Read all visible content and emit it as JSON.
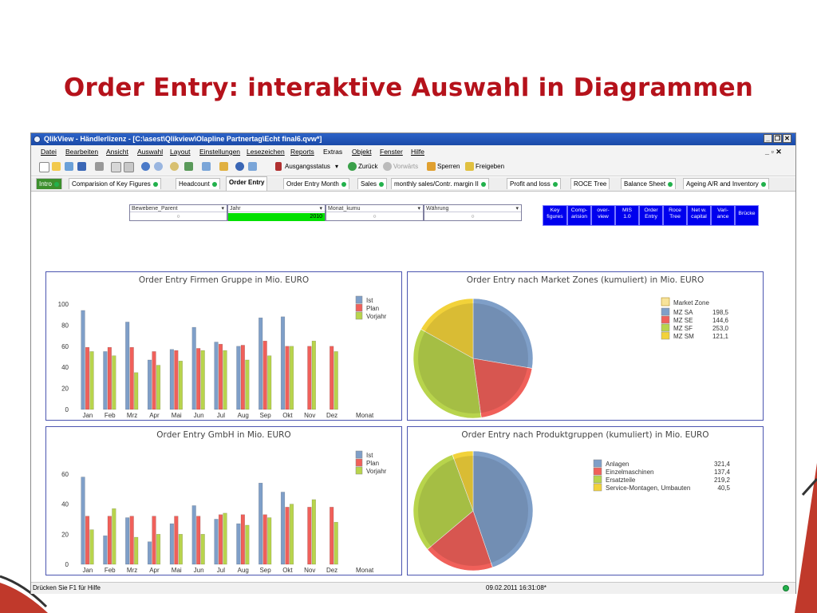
{
  "slide": {
    "title": "Order Entry: interaktive Auswahl in Diagrammen"
  },
  "window": {
    "title": "QlikView - Händlerlizenz - [C:\\asest\\Qlikview\\Olapline Partnertag\\Echt final6.qvw*]",
    "buttons": [
      "_",
      "❐",
      "✕"
    ]
  },
  "menu": {
    "items": [
      "Datei",
      "Bearbeiten",
      "Ansicht",
      "Auswahl",
      "Layout",
      "Einstellungen",
      "Lesezeichen",
      "Reports",
      "Extras",
      "Objekt",
      "Fenster",
      "Hilfe"
    ],
    "mdi_controls": "_ ▫ ✕"
  },
  "toolbar": {
    "ausgangsstatus": "Ausgangsstatus",
    "zurueck": "Zurück",
    "vorwaerts": "Vorwärts",
    "sperren": "Sperren",
    "freigeben": "Freigeben"
  },
  "tabs": [
    {
      "label": "Intro",
      "dot": true
    },
    {
      "label": "Comparision of Key Figures",
      "dot": true
    },
    {
      "label": "Headcount",
      "dot": true
    },
    {
      "label": "Order Entry",
      "dot": false
    },
    {
      "label": "Order Entry Month",
      "dot": true
    },
    {
      "label": "Sales",
      "dot": true
    },
    {
      "label": "monthly sales/Contr. margin II",
      "dot": true
    },
    {
      "label": "Profit and loss",
      "dot": true
    },
    {
      "label": "ROCE Tree",
      "dot": false
    },
    {
      "label": "Balance Sheet",
      "dot": true
    },
    {
      "label": "Ageing A/R and Inventory",
      "dot": true
    }
  ],
  "listboxes": [
    {
      "header": "Bewebene_Parent",
      "value": "○"
    },
    {
      "header": "Jahr",
      "value": "2010"
    },
    {
      "header": "Monat_kumu",
      "value": "○"
    },
    {
      "header": "Währung",
      "value": "○"
    }
  ],
  "nav_buttons": [
    {
      "line1": "Key",
      "line2": "figures"
    },
    {
      "line1": "Comp-",
      "line2": "arision"
    },
    {
      "line1": "over-",
      "line2": "view"
    },
    {
      "line1": "MIS",
      "line2": "1.0"
    },
    {
      "line1": "Order",
      "line2": "Entry"
    },
    {
      "line1": "Roce",
      "line2": "Tree"
    },
    {
      "line1": "Net w.",
      "line2": "capital"
    },
    {
      "line1": "Vari-",
      "line2": "ance"
    },
    {
      "line1": "Brücke",
      "line2": ""
    }
  ],
  "status": {
    "help": "Drücken Sie F1 für Hilfe",
    "datetime": "09.02.2011 16:31:08*"
  },
  "colors": {
    "ist": "#7f9fc8",
    "plan": "#f0605a",
    "vorjahr": "#b8d44c",
    "sm": "#f2d23a"
  },
  "chart_data": [
    {
      "type": "bar",
      "title": "Order Entry Firmen Gruppe  in Mio. EURO",
      "xlabel": "Monat",
      "categories": [
        "Jan",
        "Feb",
        "Mrz",
        "Apr",
        "Mai",
        "Jun",
        "Jul",
        "Aug",
        "Sep",
        "Okt",
        "Nov",
        "Dez"
      ],
      "ylim": [
        0,
        100
      ],
      "yticks": [
        0,
        20,
        40,
        60,
        80,
        100
      ],
      "series": [
        {
          "name": "Ist",
          "values": [
            94,
            55,
            83,
            47,
            57,
            78,
            64,
            60,
            87,
            88,
            null,
            null
          ]
        },
        {
          "name": "Plan",
          "values": [
            59,
            59,
            59,
            55,
            56,
            58,
            62,
            61,
            65,
            60,
            60,
            60
          ]
        },
        {
          "name": "Vorjahr",
          "values": [
            55,
            51,
            35,
            42,
            46,
            56,
            56,
            47,
            51,
            60,
            65,
            55
          ]
        }
      ],
      "legend": "top-right"
    },
    {
      "type": "pie",
      "title": "Order Entry  nach Market Zones (kumuliert) in Mio. EURO",
      "legend_title": "Market Zone",
      "labels": [
        "MZ SA",
        "MZ SE",
        "MZ SF",
        "MZ SM"
      ],
      "value_labels": [
        "198,5",
        "144,6",
        "253,0",
        "121,1"
      ],
      "values": [
        198.5,
        144.6,
        253.0,
        121.1
      ]
    },
    {
      "type": "bar",
      "title": "Order Entry  GmbH  in Mio. EURO",
      "xlabel": "Monat",
      "categories": [
        "Jan",
        "Feb",
        "Mrz",
        "Apr",
        "Mai",
        "Jun",
        "Jul",
        "Aug",
        "Sep",
        "Okt",
        "Nov",
        "Dez"
      ],
      "ylim": [
        0,
        70
      ],
      "yticks": [
        0,
        20,
        40,
        60
      ],
      "series": [
        {
          "name": "Ist",
          "values": [
            58,
            19,
            31,
            15,
            27,
            39,
            30,
            27,
            54,
            48,
            null,
            null
          ]
        },
        {
          "name": "Plan",
          "values": [
            32,
            32,
            32,
            32,
            32,
            32,
            33,
            33,
            33,
            38,
            38,
            38
          ]
        },
        {
          "name": "Vorjahr",
          "values": [
            23,
            37,
            18,
            20,
            20,
            20,
            34,
            26,
            31,
            40,
            43,
            28
          ]
        }
      ],
      "legend": "top-right"
    },
    {
      "type": "pie",
      "title": "Order Entry  nach Produktgruppen (kumuliert) in Mio. EURO",
      "labels": [
        "Anlagen",
        "Einzelmaschinen",
        "Ersatzteile",
        "Service-Montagen, Umbauten"
      ],
      "value_labels": [
        "321,4",
        "137,4",
        "219,2",
        "40,5"
      ],
      "values": [
        321.4,
        137.4,
        219.2,
        40.5
      ]
    }
  ]
}
